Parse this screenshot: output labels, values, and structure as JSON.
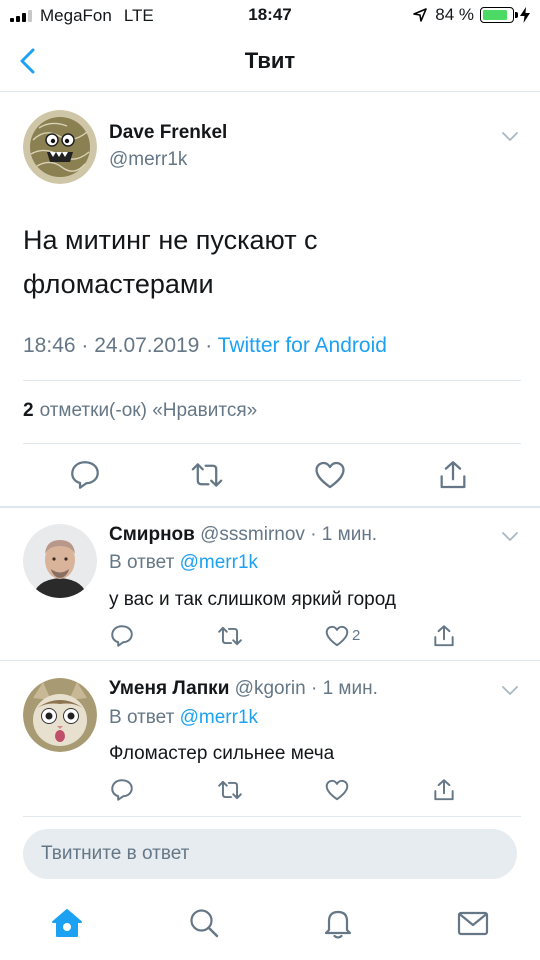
{
  "status_bar": {
    "carrier": "MegaFon",
    "network": "LTE",
    "time": "18:47",
    "battery": "84 %",
    "battery_level": 0.84
  },
  "nav": {
    "title": "Твит"
  },
  "tweet": {
    "display_name": "Dave Frenkel",
    "handle": "@merr1k",
    "text_line1": "На митинг не пускают с",
    "text_line2": "фломастерами",
    "time": "18:46",
    "date": "24.07.2019",
    "separator": "·",
    "source": "Twitter for Android",
    "likes_count": "2",
    "likes_label": "отметки(-ок) «Нравится»"
  },
  "replies": [
    {
      "name": "Смирнов",
      "handle": "@sssmirnov",
      "time": "· 1 мин.",
      "in_reply_label": "В ответ",
      "in_reply_to": "@merr1k",
      "text": "у вас и так слишком яркий город",
      "like_count": "2"
    },
    {
      "name": "Уменя Лапки",
      "handle": "@kgorin",
      "time": "· 1 мин.",
      "in_reply_label": "В ответ",
      "in_reply_to": "@merr1k",
      "text": "Фломастер сильнее меча",
      "like_count": ""
    }
  ],
  "composer": {
    "placeholder": "Твитните в ответ"
  },
  "icons": {
    "back": "chevron-left-icon",
    "more": "chevron-down-icon",
    "reply": "reply-icon",
    "retweet": "retweet-icon",
    "like": "heart-icon",
    "share": "share-icon",
    "home": "home-icon",
    "search": "search-icon",
    "notifications": "bell-icon",
    "messages": "mail-icon"
  },
  "colors": {
    "accent": "#1da1f2",
    "secondary_text": "#657786",
    "divider": "#e1e8ed",
    "battery": "#4cd964"
  }
}
